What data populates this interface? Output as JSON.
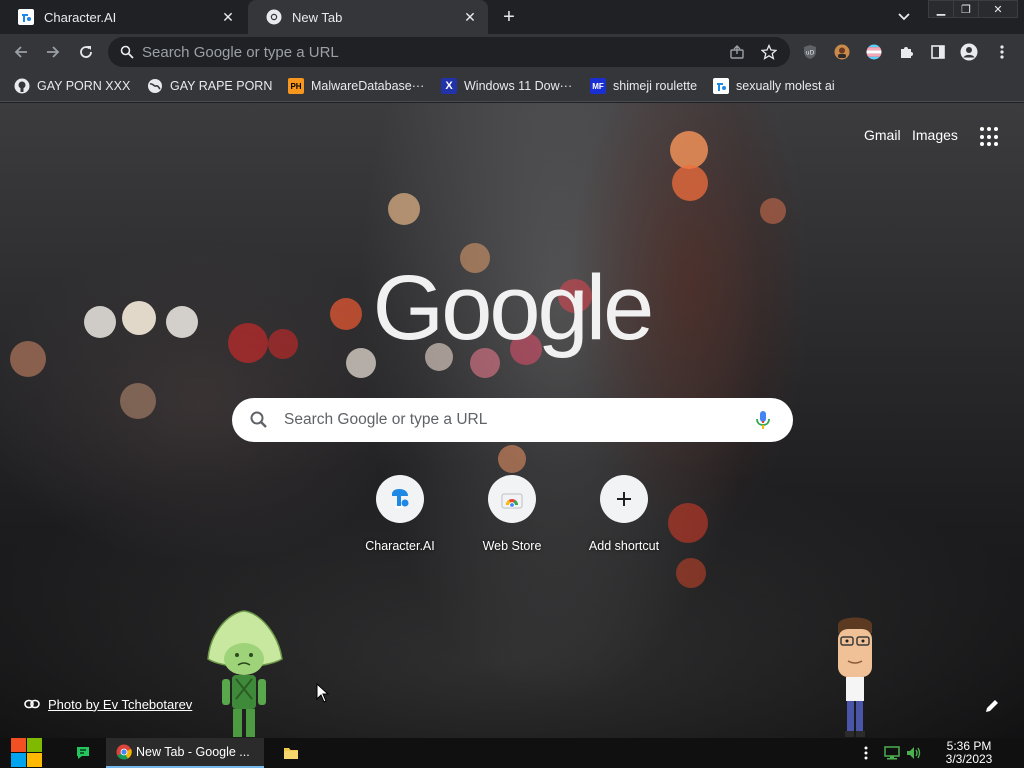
{
  "tabs": [
    {
      "title": "Character.AI",
      "favicon": "character-ai-icon",
      "active": false
    },
    {
      "title": "New Tab",
      "favicon": "chrome-icon",
      "active": true
    }
  ],
  "window_controls": [
    "minimize",
    "restore",
    "close"
  ],
  "omnibox": {
    "placeholder": "Search Google or type a URL"
  },
  "bookmarks": [
    {
      "label": "GAY PORN XXX",
      "icon": "github-icon"
    },
    {
      "label": "GAY RAPE PORN",
      "icon": "globe-icon"
    },
    {
      "label": "MalwareDatabase···",
      "icon": "ph-icon",
      "icon_text": "PH"
    },
    {
      "label": "Windows 11 Dow···",
      "icon": "x-icon",
      "icon_text": "X"
    },
    {
      "label": "shimeji roulette",
      "icon": "mf-icon",
      "icon_text": "MF"
    },
    {
      "label": "sexually molest ai",
      "icon": "character-ai-icon"
    }
  ],
  "ntp": {
    "gmail": "Gmail",
    "images": "Images",
    "logo": "Google",
    "search_placeholder": "Search Google or type a URL",
    "shortcuts": [
      {
        "label": "Character.AI",
        "icon": "character-ai-icon"
      },
      {
        "label": "Web Store",
        "icon": "chrome-web-store-icon"
      },
      {
        "label": "Add shortcut",
        "icon": "plus-icon"
      }
    ],
    "photo_credit": "Photo by Ev Tchebotarev"
  },
  "taskbar": {
    "chrome_window_title": "New Tab - Google ...",
    "time": "5:36 PM",
    "date": "3/3/2023"
  },
  "colors": {
    "tab_active": "#35363a",
    "tab_strip": "#202124",
    "accent_blue": "#8ab4f8"
  }
}
